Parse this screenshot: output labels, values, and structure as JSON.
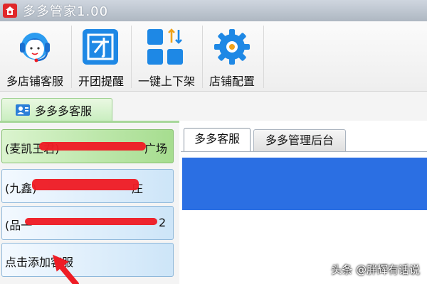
{
  "window": {
    "title": "多多管家1.00"
  },
  "toolbar": {
    "buttons": [
      {
        "label": "多店铺客服",
        "icon": "headset-avatar-icon"
      },
      {
        "label": "开团提醒",
        "icon": "group-tuan-icon"
      },
      {
        "label": "一键上下架",
        "icon": "grid-updown-icon"
      },
      {
        "label": "店铺配置",
        "icon": "gear-icon"
      }
    ]
  },
  "left_tab": {
    "label": "多多多客服"
  },
  "services": [
    {
      "text": "(麦凯王君)",
      "suffix": "广场",
      "active": true
    },
    {
      "text": "(九鑫)",
      "suffix": "庄",
      "active": false
    },
    {
      "text": "(品一",
      "suffix": "2",
      "active": false
    },
    {
      "text": "点击添加客服",
      "suffix": "",
      "active": false
    }
  ],
  "right_tabs": [
    {
      "label": "多多客服",
      "active": true
    },
    {
      "label": "多多管理后台",
      "active": false
    }
  ],
  "watermark": "头条 @胖辉有话说",
  "colors": {
    "accent_blue": "#2b6fe3",
    "annotation_red": "#ee1c25",
    "icon_blue": "#1e88e5"
  }
}
